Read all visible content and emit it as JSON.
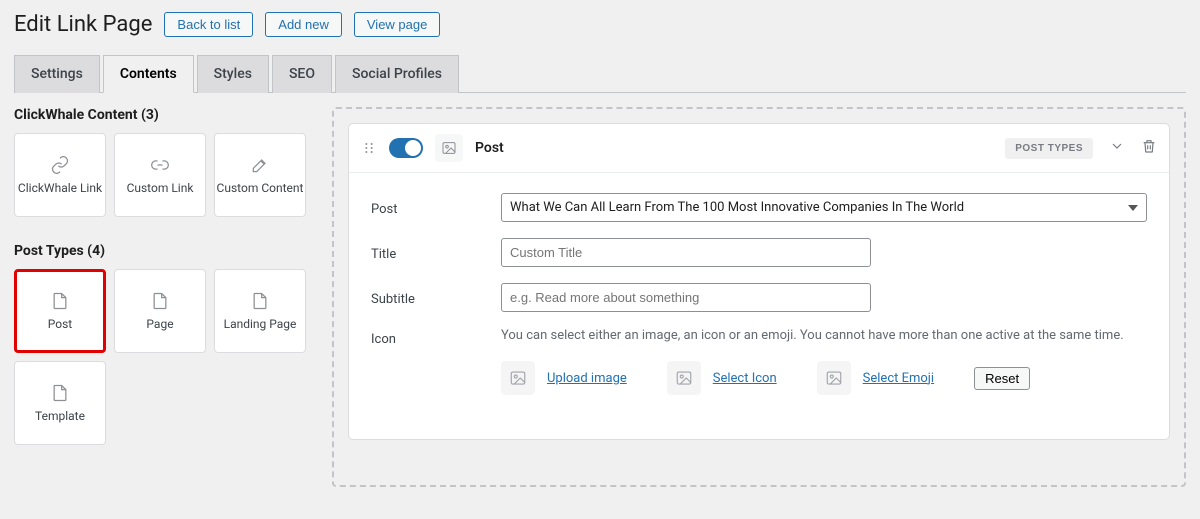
{
  "header": {
    "title": "Edit Link Page",
    "back_btn": "Back to list",
    "add_btn": "Add new",
    "view_btn": "View page"
  },
  "tabs": {
    "settings": "Settings",
    "contents": "Contents",
    "styles": "Styles",
    "seo": "SEO",
    "social": "Social Profiles"
  },
  "sidebar": {
    "clickwhale_heading": "ClickWhale Content (3)",
    "clickwhale_items": [
      {
        "label": "ClickWhale Link"
      },
      {
        "label": "Custom Link"
      },
      {
        "label": "Custom Content"
      }
    ],
    "posttypes_heading": "Post Types (4)",
    "posttype_items": [
      {
        "label": "Post",
        "selected": true
      },
      {
        "label": "Page"
      },
      {
        "label": "Landing Page"
      },
      {
        "label": "Template"
      }
    ]
  },
  "panel": {
    "title": "Post",
    "badge": "POST TYPES",
    "fields": {
      "post_label": "Post",
      "post_value": "What We Can All Learn From The 100 Most Innovative Companies In The World",
      "title_label": "Title",
      "title_placeholder": "Custom Title",
      "subtitle_label": "Subtitle",
      "subtitle_placeholder": "e.g. Read more about something",
      "icon_label": "Icon",
      "icon_help": "You can select either an image, an icon or an emoji. You cannot have more than one active at the same time.",
      "upload_image": "Upload image",
      "select_icon": "Select Icon",
      "select_emoji": "Select Emoji",
      "reset": "Reset"
    }
  }
}
